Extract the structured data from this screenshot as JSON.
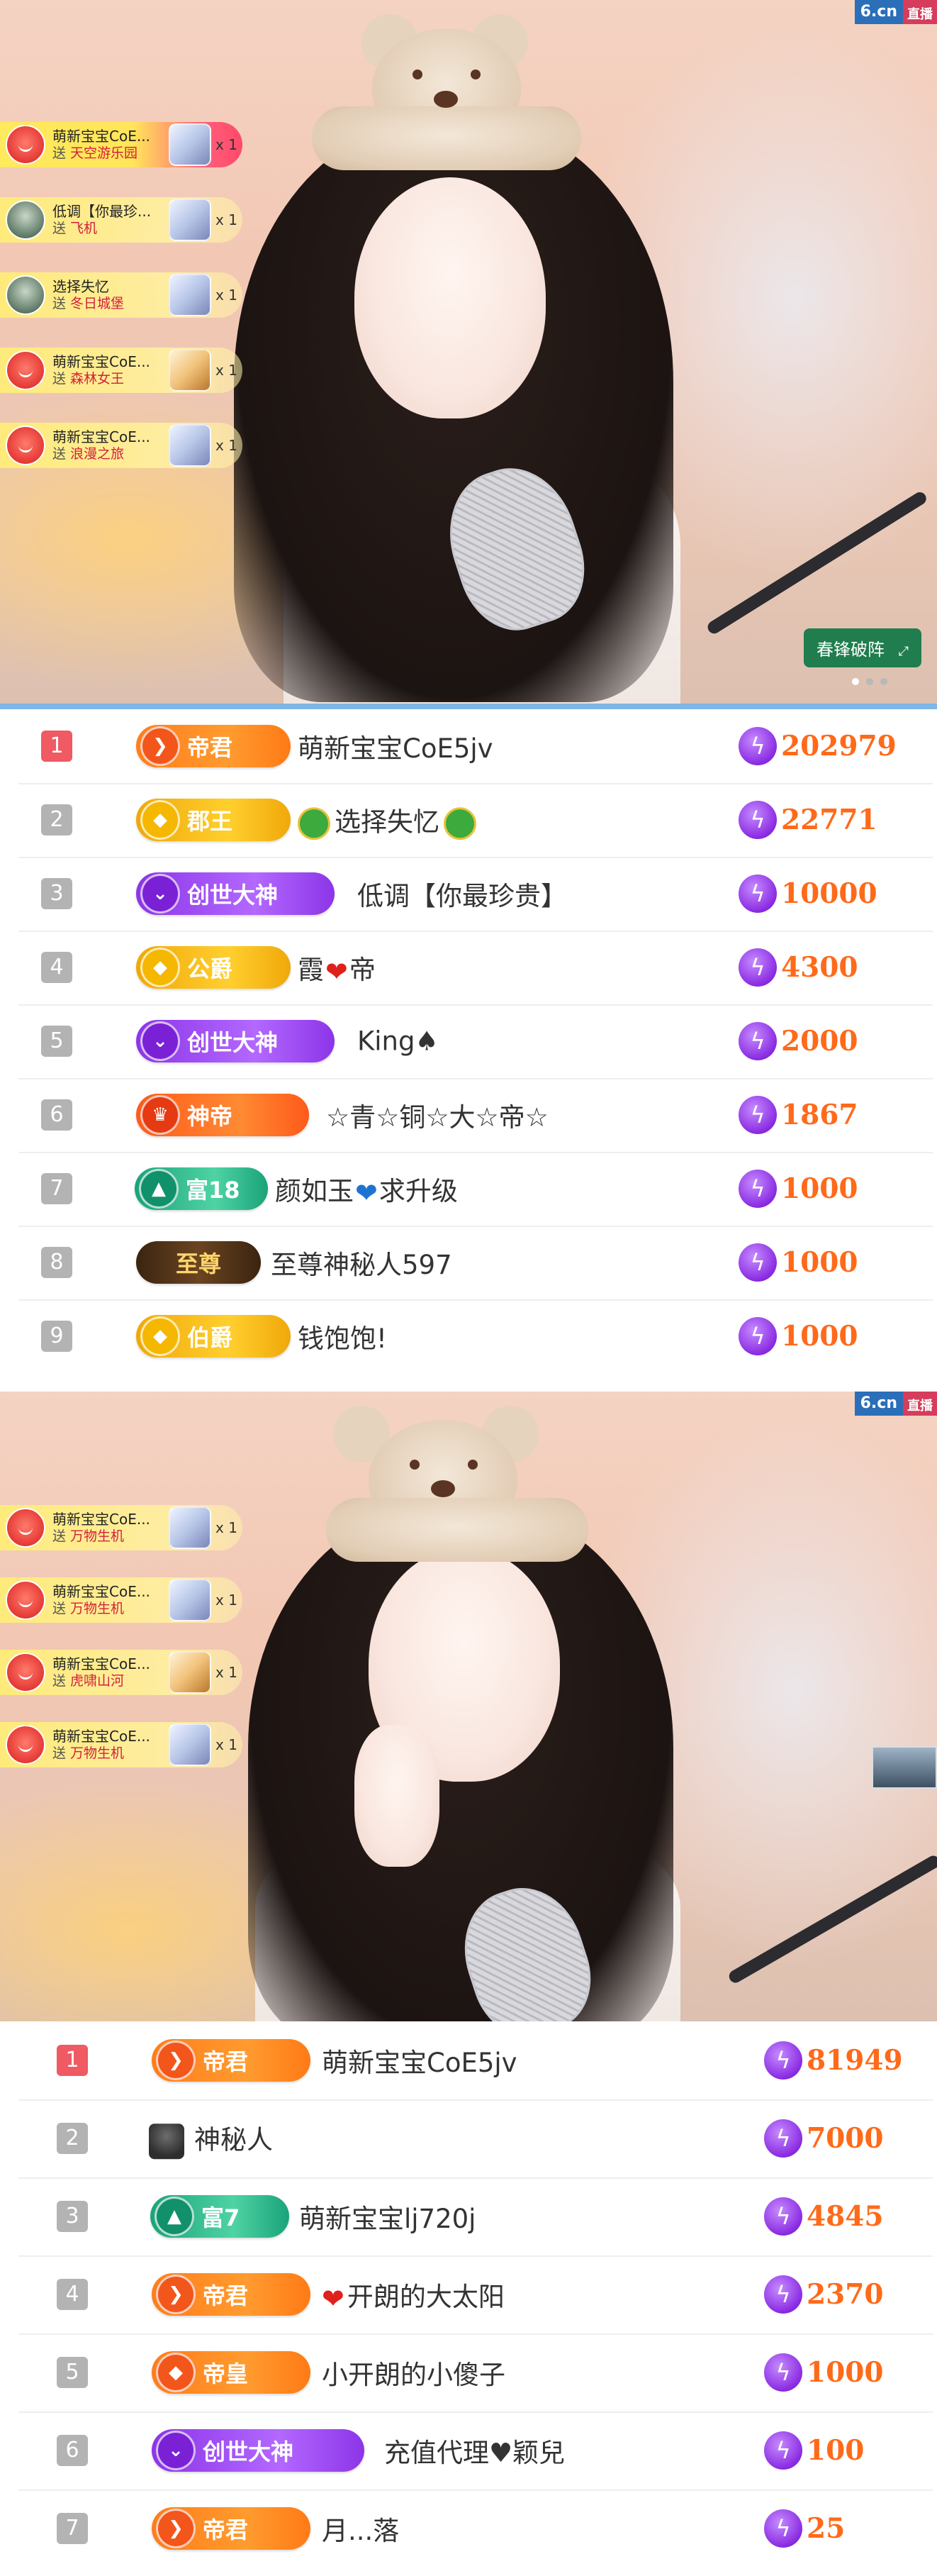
{
  "brand": {
    "logo_main": "6.cn",
    "logo_tag": "直播"
  },
  "stream_top": {
    "gift_feed": [
      {
        "name": "萌新宝宝CoE...",
        "gift": "天空游乐园",
        "count": "x 1"
      },
      {
        "name": "低调【你最珍...",
        "gift": "飞机",
        "count": "x 1"
      },
      {
        "name": "选择失忆",
        "gift": "冬日城堡",
        "count": "x 1"
      },
      {
        "name": "萌新宝宝CoE...",
        "gift": "森林女王",
        "count": "x 1"
      },
      {
        "name": "萌新宝宝CoE...",
        "gift": "浪漫之旅",
        "count": "x 1"
      }
    ],
    "send_label": "送",
    "tag": "春锋破阵"
  },
  "ranking_top": [
    {
      "rank": "1",
      "badge": "帝君",
      "name": "萌新宝宝CoE5jv",
      "score": "202979"
    },
    {
      "rank": "2",
      "badge": "郡王",
      "name": "选择失忆",
      "score": "22771"
    },
    {
      "rank": "3",
      "badge": "创世大神",
      "name": "低调【你最珍贵】",
      "score": "10000"
    },
    {
      "rank": "4",
      "badge": "公爵",
      "name_a": "霞",
      "name_b": "帝",
      "score": "4300"
    },
    {
      "rank": "5",
      "badge": "创世大神",
      "name": "King♠",
      "score": "2000"
    },
    {
      "rank": "6",
      "badge": "神帝",
      "name": "☆青☆铜☆大☆帝☆",
      "score": "1867"
    },
    {
      "rank": "7",
      "badge": "富18",
      "name_a": "颜如玉",
      "name_b": "求升级",
      "score": "1000"
    },
    {
      "rank": "8",
      "badge": "至尊",
      "name": "至尊神秘人597",
      "score": "1000"
    },
    {
      "rank": "9",
      "badge": "伯爵",
      "name": "钱饱饱!",
      "score": "1000"
    }
  ],
  "stream_bottom": {
    "gift_feed": [
      {
        "name": "萌新宝宝CoE...",
        "gift": "万物生机",
        "count": "x 1"
      },
      {
        "name": "萌新宝宝CoE...",
        "gift": "万物生机",
        "count": "x 1"
      },
      {
        "name": "萌新宝宝CoE...",
        "gift": "虎啸山河",
        "count": "x 1"
      },
      {
        "name": "萌新宝宝CoE...",
        "gift": "万物生机",
        "count": "x 1"
      }
    ],
    "send_label": "送"
  },
  "ranking_bottom": [
    {
      "rank": "1",
      "badge": "帝君",
      "name": "萌新宝宝CoE5jv",
      "score": "81949"
    },
    {
      "rank": "2",
      "badge": "",
      "name": "神秘人",
      "score": "7000"
    },
    {
      "rank": "3",
      "badge": "富7",
      "name": "萌新宝宝lj720j",
      "score": "4845"
    },
    {
      "rank": "4",
      "badge": "帝君",
      "name": "开朗的大太阳",
      "score": "2370"
    },
    {
      "rank": "5",
      "badge": "帝皇",
      "name": "小开朗的小傻子",
      "score": "1000"
    },
    {
      "rank": "6",
      "badge": "创世大神",
      "name": "充值代理♥颖兒",
      "score": "100"
    },
    {
      "rank": "7",
      "badge": "帝君",
      "name": "月...落",
      "score": "25"
    }
  ],
  "colors": {
    "score": "#ff6a1a",
    "first_rank": "#ef5a63",
    "bolt": "#8a2be2"
  },
  "icons": {
    "currency": "lightning-icon",
    "badge": "level-emblem-icon",
    "mystery": "incognito-icon"
  }
}
